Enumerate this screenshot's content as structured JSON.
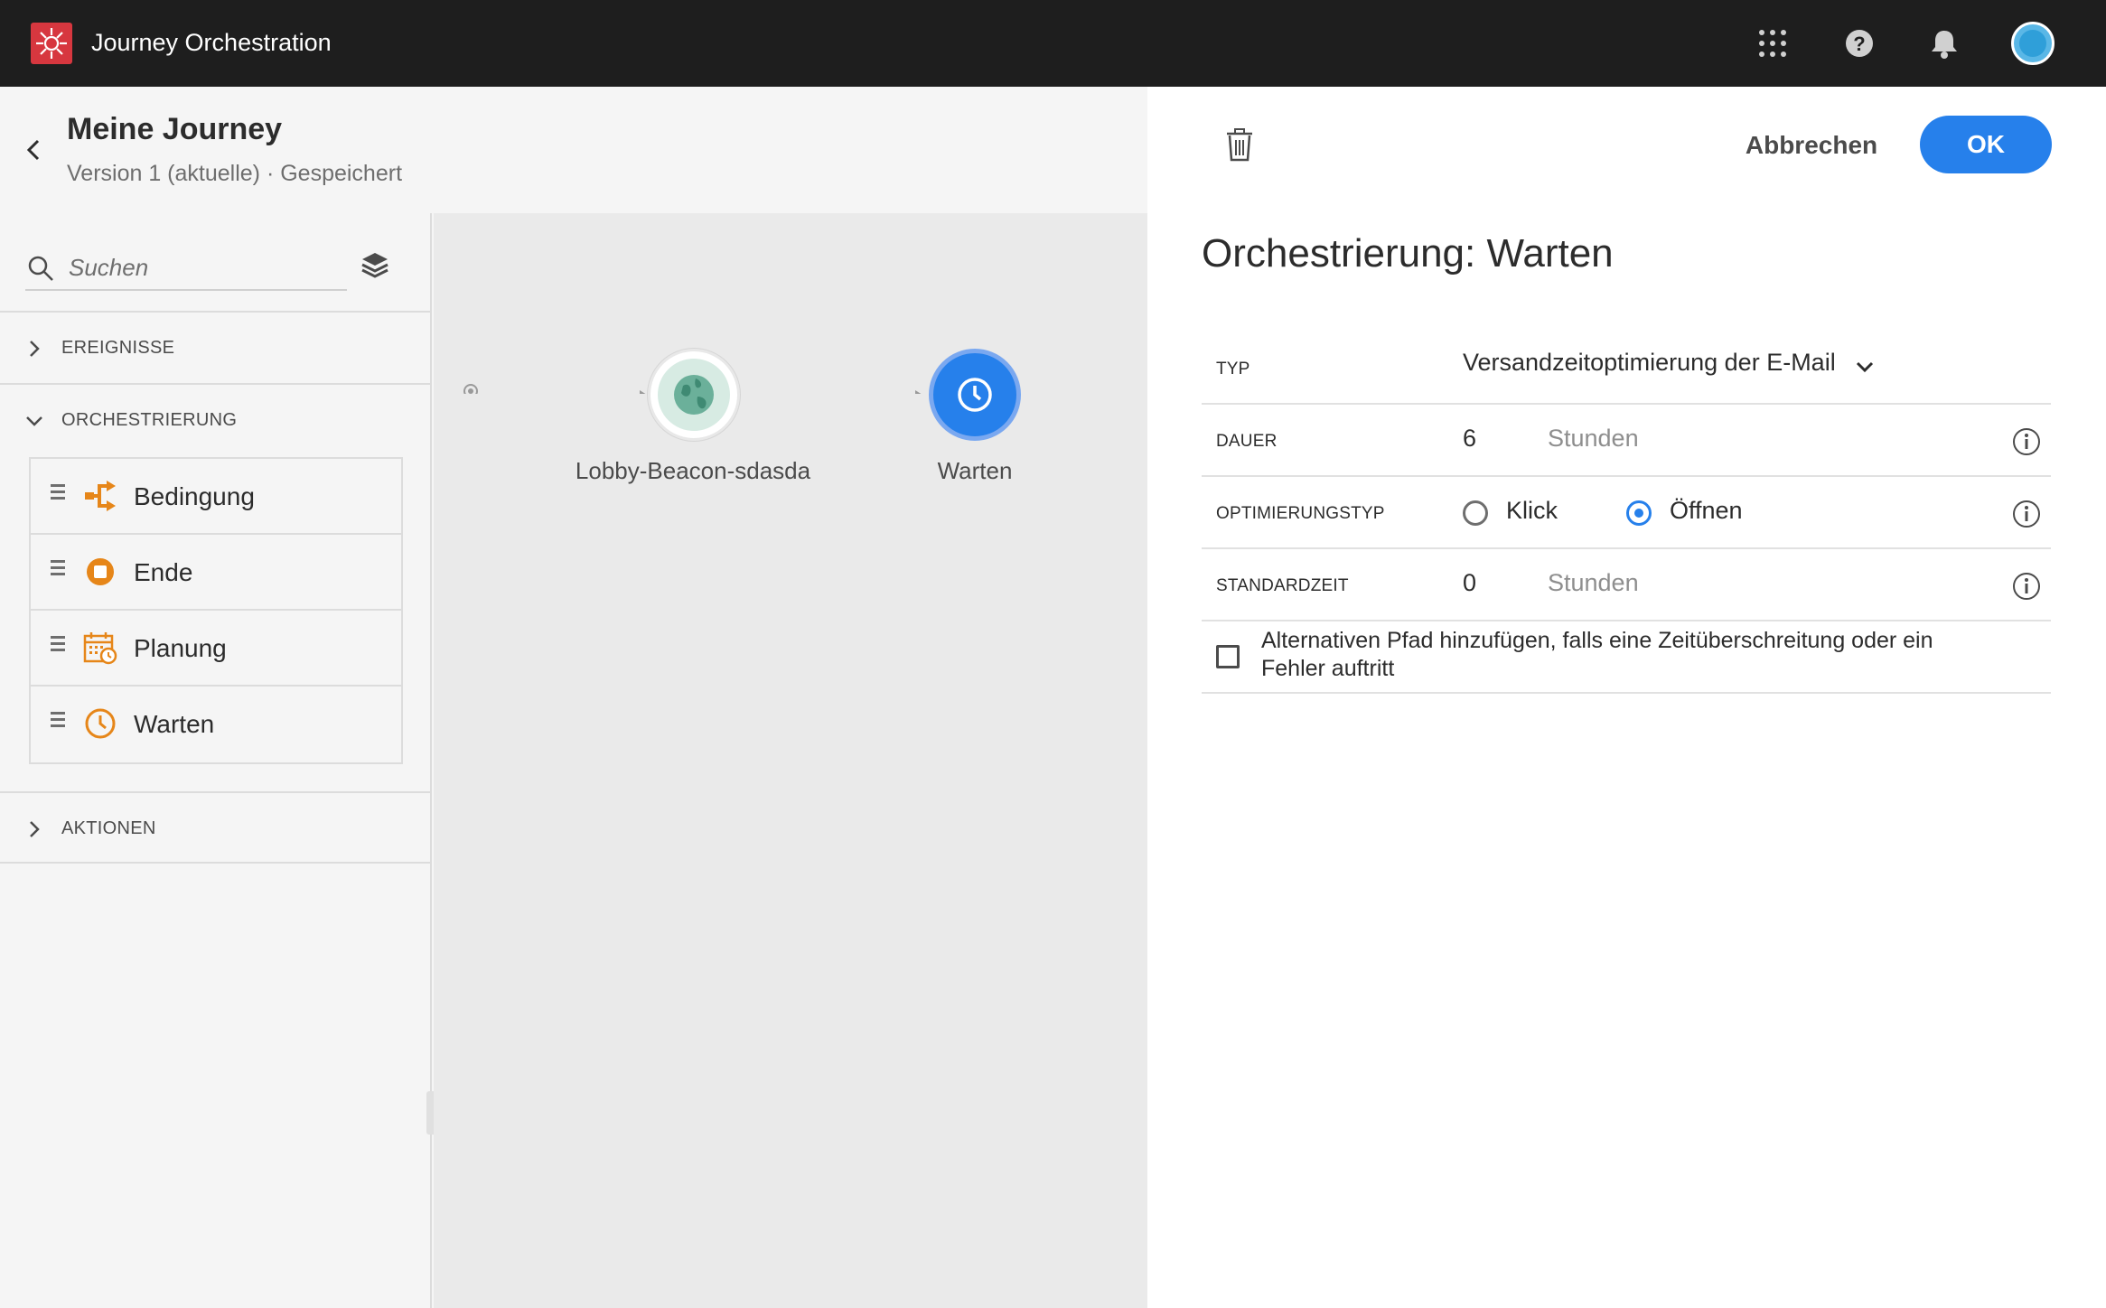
{
  "app": {
    "title": "Journey Orchestration"
  },
  "colors": {
    "accent": "#2680eb",
    "topbar": "#1e1e1e",
    "logo": "#d7373f",
    "orchestration_icon": "#e68619",
    "event_node": "#6bb09a"
  },
  "topbar_icons": [
    "apps-grid-icon",
    "help-icon",
    "notification-bell-icon",
    "user-avatar"
  ],
  "journey": {
    "title": "Meine Journey",
    "subtitle": "Version 1 (aktuelle) · Gespeichert"
  },
  "palette": {
    "search_placeholder": "Suchen",
    "sections": [
      {
        "label": "EREIGNISSE",
        "expanded": false
      },
      {
        "label": "ORCHESTRIERUNG",
        "expanded": true
      },
      {
        "label": "AKTIONEN",
        "expanded": false
      }
    ],
    "orchestration_items": [
      {
        "label": "Bedingung",
        "icon": "condition-icon"
      },
      {
        "label": "Ende",
        "icon": "end-icon"
      },
      {
        "label": "Planung",
        "icon": "calendar-icon"
      },
      {
        "label": "Warten",
        "icon": "clock-icon"
      }
    ]
  },
  "canvas": {
    "nodes": [
      {
        "label": "Lobby-Beacon-sdasda",
        "icon": "globe-icon"
      },
      {
        "label": "Warten",
        "icon": "clock-icon",
        "selected": true
      }
    ]
  },
  "panel": {
    "cancel_label": "Abbrechen",
    "ok_label": "OK",
    "title": "Orchestrierung: Warten",
    "typ": {
      "label": "TYP",
      "value": "Versandzeitoptimierung der E-Mail"
    },
    "dauer": {
      "label": "DAUER",
      "value": "6",
      "unit": "Stunden"
    },
    "optimierungstyp": {
      "label": "OPTIMIERUNGSTYP",
      "options": [
        "Klick",
        "Öffnen"
      ],
      "selected": "Öffnen"
    },
    "standardzeit": {
      "label": "STANDARDZEIT",
      "value": "0",
      "unit": "Stunden"
    },
    "alt_path": {
      "label": "Alternativen Pfad hinzufügen, falls eine Zeitüberschreitung oder ein Fehler auftritt",
      "checked": false
    }
  }
}
